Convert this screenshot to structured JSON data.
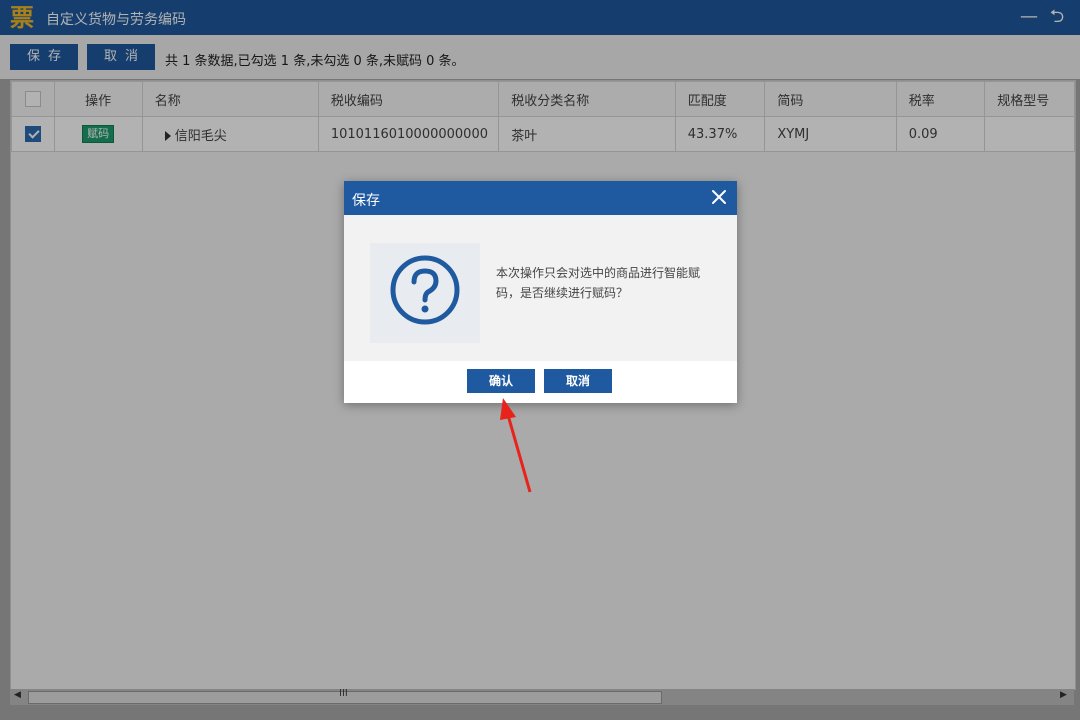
{
  "window": {
    "title": "自定义货物与劳务编码",
    "logo_char": "票",
    "minimize": "—",
    "back": "⮌"
  },
  "toolbar": {
    "save_label": "保存",
    "cancel_label": "取消",
    "info": "共 1 条数据,已勾选 1 条,未勾选 0 条,未赋码 0 条。"
  },
  "table": {
    "columns": [
      "操作",
      "名称",
      "税收编码",
      "税收分类名称",
      "匹配度",
      "简码",
      "税率",
      "规格型号"
    ],
    "rows": [
      {
        "checked": true,
        "action": "赋码",
        "name": "信阳毛尖",
        "tax_code": "1010116010000000000",
        "tax_class": "茶叶",
        "match": "43.37%",
        "short_code": "XYMJ",
        "rate": "0.09",
        "spec": ""
      }
    ]
  },
  "scrollbar": {
    "grip": "III",
    "left_arrow": "◀",
    "right_arrow": "▶"
  },
  "dialog": {
    "title": "保存",
    "close": "✕",
    "message": "本次操作只会对选中的商品进行智能赋码，是否继续进行赋码？",
    "confirm_label": "确认",
    "cancel_label": "取消"
  },
  "colors": {
    "primary": "#1f5aa0",
    "badge": "#1e9e6e",
    "logo": "#f3b928",
    "annotation_arrow": "#e8231b"
  }
}
